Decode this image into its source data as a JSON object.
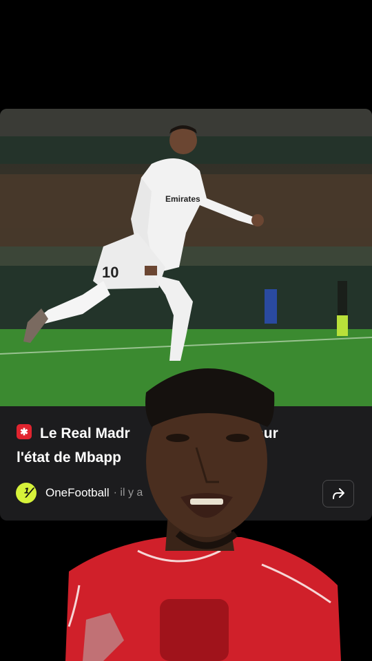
{
  "article": {
    "badge_icon": "news-alert-icon",
    "title_line1": "Le Real Madr",
    "title_line1_tail": "ue sur",
    "title_line2": "l'état de Mbapp",
    "source_name": "OneFootball",
    "source_time": "· il y a",
    "source_logo_text": "⅟",
    "share_icon": "share-icon",
    "player_number": "10",
    "jersey_text": "Emirates"
  },
  "colors": {
    "card_bg": "#1c1c1e",
    "brand_accent": "#d6f23a",
    "badge_red": "#e0242f",
    "presenter_jersey": "#d0202a"
  }
}
